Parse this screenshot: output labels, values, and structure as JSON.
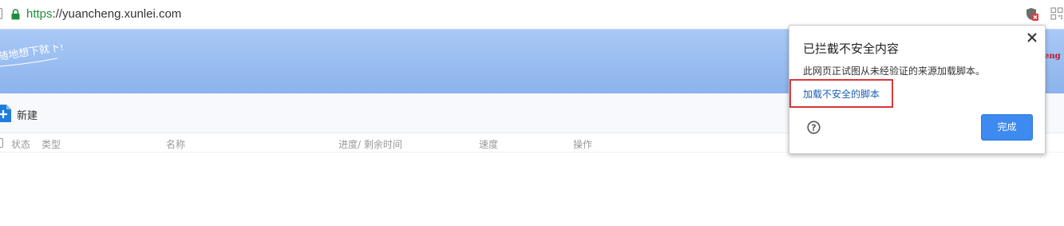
{
  "address_bar": {
    "url_scheme": "https",
    "url_rest": "://yuancheng.xunlei.com",
    "icons": [
      "lock-icon",
      "shield-blocked-icon",
      "qr-code-icon"
    ]
  },
  "banner": {
    "slogan": "随地想下就下!",
    "brand_fragment": "eng"
  },
  "toolbar": {
    "new_label": "新建"
  },
  "table": {
    "columns": [
      "状态",
      "类型",
      "名称",
      "进度/ 剩余时间",
      "速度",
      "操作"
    ]
  },
  "popup": {
    "title": "已拦截不安全内容",
    "description": "此网页正试图从未经验证的来源加载脚本。",
    "link": "加载不安全的脚本",
    "done_label": "完成",
    "colors": {
      "accent": "#3d8af0",
      "highlight": "#d9383a",
      "link": "#1a5fb4"
    }
  }
}
